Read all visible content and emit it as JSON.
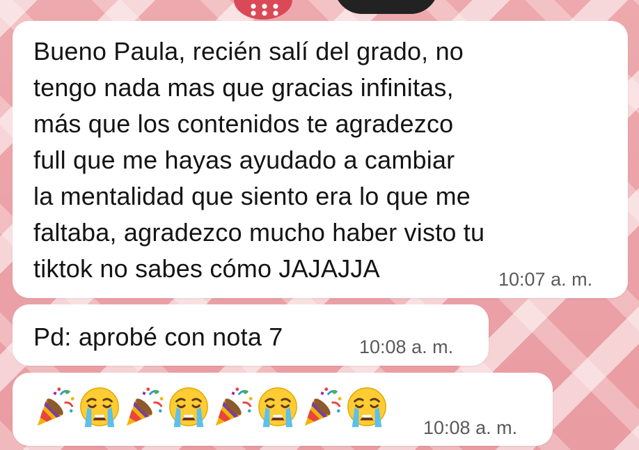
{
  "messages": [
    {
      "text": "Bueno Paula, recién salí del grado, no\ntengo nada mas que gracias infinitas,\nmás que los contenidos te agradezco\nfull que me hayas ayudado a cambiar\nla mentalidad que siento era lo que me\nfaltaba, agradezco mucho haber visto tu\ntiktok no sabes cómo JAJAJJA",
      "time": "10:07 a. m."
    },
    {
      "text": "Pd: aprobé con nota 7",
      "time": "10:08 a. m."
    },
    {
      "emojis": [
        "party-popper",
        "loudly-crying-face",
        "party-popper",
        "loudly-crying-face",
        "party-popper",
        "loudly-crying-face",
        "party-popper",
        "loudly-crying-face"
      ],
      "time": "10:08 a. m."
    }
  ],
  "colors": {
    "bubble": "#ffffff",
    "wallpaper": "#e9a4a8",
    "text": "#141414",
    "timestamp": "#5a5a5a"
  }
}
